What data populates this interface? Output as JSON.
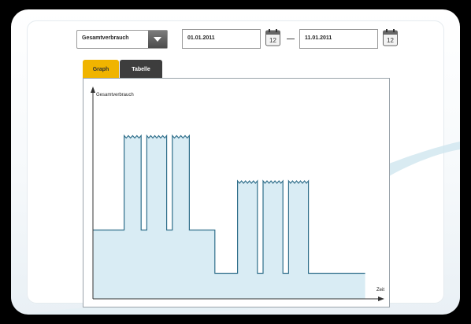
{
  "toolbar": {
    "dropdown_value": "Gesamtverbrauch",
    "date_from": "01.01.2011",
    "date_to": "11.01.2011",
    "calendar_day": "12"
  },
  "tabs": [
    {
      "label": "Graph",
      "active": true
    },
    {
      "label": "Tabelle",
      "active": false
    }
  ],
  "colors": {
    "active_tab": "#f0b400",
    "inactive_tab": "#3d3d3d",
    "series_fill": "#d9ecf4",
    "series_line": "#2f6e8a"
  },
  "chart_data": {
    "type": "area",
    "title": "",
    "ylabel": "Gesamtverbrauch",
    "xlabel": "Zeit",
    "ylim": [
      0,
      100
    ],
    "xlim": [
      0,
      100
    ],
    "grid": false,
    "series": [
      {
        "values": [
          [
            0,
            35
          ],
          [
            11,
            35
          ],
          [
            11,
            83
          ],
          [
            17,
            83
          ],
          [
            17,
            35
          ],
          [
            19,
            35
          ],
          [
            19,
            83
          ],
          [
            26,
            83
          ],
          [
            26,
            35
          ],
          [
            28,
            35
          ],
          [
            28,
            83
          ],
          [
            34,
            83
          ],
          [
            34,
            35
          ],
          [
            43,
            35
          ],
          [
            43,
            13
          ],
          [
            51,
            13
          ],
          [
            51,
            60
          ],
          [
            58,
            60
          ],
          [
            58,
            13
          ],
          [
            60,
            13
          ],
          [
            60,
            60
          ],
          [
            67,
            60
          ],
          [
            67,
            13
          ],
          [
            69,
            13
          ],
          [
            69,
            60
          ],
          [
            76,
            60
          ],
          [
            76,
            13
          ],
          [
            96,
            13
          ]
        ]
      }
    ]
  }
}
